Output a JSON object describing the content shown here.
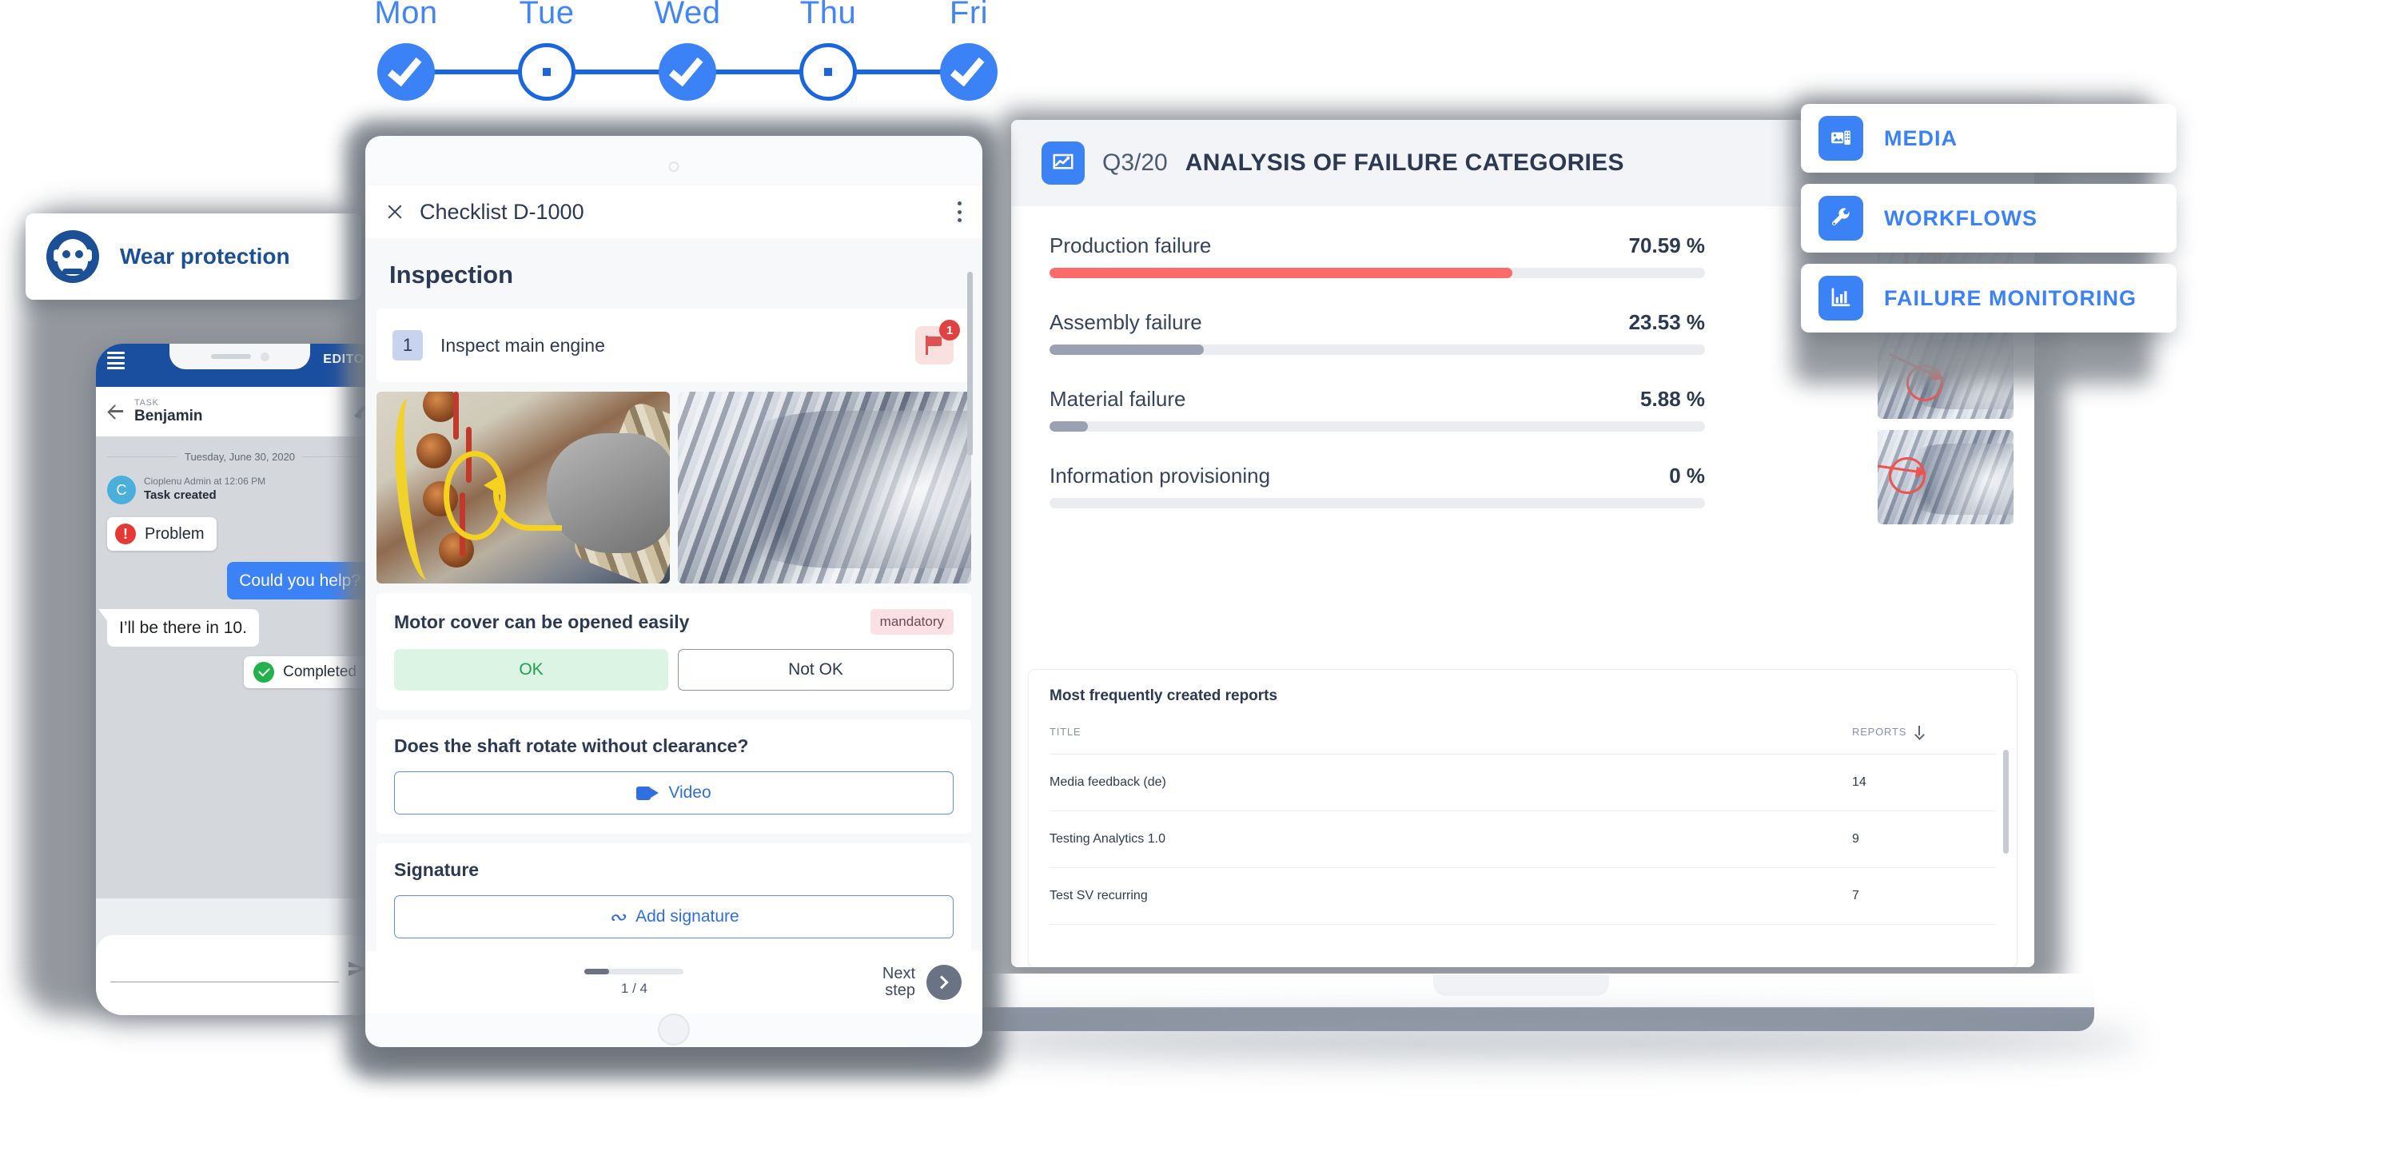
{
  "week_stepper": {
    "days": [
      {
        "label": "Mon",
        "state": "done"
      },
      {
        "label": "Tue",
        "state": "todo"
      },
      {
        "label": "Wed",
        "state": "done"
      },
      {
        "label": "Thu",
        "state": "todo"
      },
      {
        "label": "Fri",
        "state": "done"
      }
    ],
    "accent_color": "#3b82f6",
    "line_color": "#1a66e0"
  },
  "safety_card": {
    "label": "Wear protection",
    "icon": "respirator-mask-icon",
    "color": "#1b4f96"
  },
  "phone": {
    "status_bar": {
      "menu_icon": "hamburger-icon",
      "mode_badge": "EDITOR"
    },
    "app_bar": {
      "kicker": "TASK",
      "title": "Benjamin",
      "back_icon": "back-arrow-icon",
      "edit_icon": "pencil-icon"
    },
    "chat": {
      "date_divider": "Tuesday, June 30, 2020",
      "event": {
        "avatar_letter": "C",
        "meta": "Cioplenu Admin at 12:06 PM",
        "text": "Task created"
      },
      "problem_chip": "Problem",
      "messages": [
        {
          "text": "Could you help?",
          "direction": "out"
        },
        {
          "text": "I’ll be there in 10.",
          "direction": "in"
        }
      ],
      "completed_chip": "Completed",
      "input_placeholder": "",
      "send_icon": "send-icon"
    }
  },
  "checklist": {
    "header": {
      "close_icon": "close-icon",
      "title": "Checklist D-1000",
      "menu_icon": "kebab-menu-icon"
    },
    "section_title": "Inspection",
    "task": {
      "number": "1",
      "name": "Inspect main engine",
      "flag_icon": "flag-icon",
      "flag_count": "1"
    },
    "photos": [
      {
        "name": "motor-stator-photo",
        "annotation": "yellow-ellipse-arrow"
      },
      {
        "name": "gearbox-photo",
        "annotation": "none"
      }
    ],
    "questions": [
      {
        "text": "Motor cover can be opened easily",
        "badge": "mandatory",
        "options": [
          {
            "label": "OK",
            "state": "selected"
          },
          {
            "label": "Not OK",
            "state": "unselected"
          }
        ]
      },
      {
        "text": "Does the shaft rotate without clearance?",
        "action": "Video",
        "action_icon": "video-icon"
      }
    ],
    "signature": {
      "label": "Signature",
      "button": "Add signature",
      "icon": "signature-icon"
    },
    "footer": {
      "progress_text": "1 / 4",
      "progress_percent": 25,
      "next_label_line1": "Next",
      "next_label_line2": "step",
      "next_icon": "chevron-right-icon"
    }
  },
  "dashboard": {
    "header": {
      "icon": "analytics-chart-icon",
      "quarter": "Q3/20",
      "title": "ANALYSIS OF FAILURE CATEGORIES"
    },
    "chart_data": {
      "type": "bar",
      "title": "ANALYSIS OF FAILURE CATEGORIES",
      "subtitle": "Q3/20",
      "orientation": "horizontal",
      "categories": [
        "Production failure",
        "Assembly failure",
        "Material failure",
        "Information provisioning"
      ],
      "values": [
        70.59,
        23.53,
        5.88,
        0
      ],
      "value_labels": [
        "70.59 %",
        "23.53 %",
        "5.88 %",
        "0 %"
      ],
      "colors": [
        "#fd6a6a",
        "#9aa2b1",
        "#9aa2b1",
        "#eaecef"
      ],
      "track_color": "#eaecef",
      "xlabel": "",
      "ylabel": "",
      "xlim": [
        0,
        100
      ],
      "grid": false,
      "legend": "none"
    },
    "thumbnails": [
      {
        "name": "gearbox-thumb-1",
        "annotation": "red-circle-arrow"
      },
      {
        "name": "gearbox-thumb-2",
        "annotation": "red-circle-arrow"
      },
      {
        "name": "gearbox-thumb-3",
        "annotation": "red-circle-arrow"
      }
    ],
    "reports": {
      "title": "Most frequently created reports",
      "columns": [
        "TITLE",
        "REPORTS"
      ],
      "sort_icon": "sort-descending-icon",
      "rows": [
        {
          "title": "Media feedback (de)",
          "reports": "14"
        },
        {
          "title": "Testing Analytics 1.0",
          "reports": "9"
        },
        {
          "title": "Test SV recurring",
          "reports": "7"
        }
      ]
    }
  },
  "menu_cards": [
    {
      "label": "MEDIA",
      "icon": "media-image-icon"
    },
    {
      "label": "WORKFLOWS",
      "icon": "wrench-icon"
    },
    {
      "label": "FAILURE MONITORING",
      "icon": "bar-chart-icon"
    }
  ]
}
